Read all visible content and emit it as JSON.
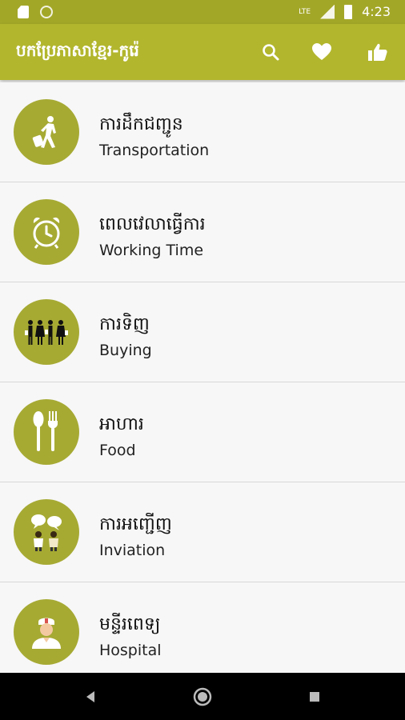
{
  "status": {
    "time": "4:23",
    "network": "LTE"
  },
  "app": {
    "title": "បកប្រែភាសាខ្មែរ-កូរ៉េ",
    "accent": "#b2b62d",
    "icon_color": "#a6aa33"
  },
  "actions": [
    {
      "icon": "search-icon"
    },
    {
      "icon": "heart-icon"
    },
    {
      "icon": "thumbs-up-icon"
    }
  ],
  "categories": [
    {
      "kh": "ការដឹកជញ្ជូន",
      "en": "Transportation",
      "icon": "traveler-icon"
    },
    {
      "kh": "ពេលវេលាធ្វើការ",
      "en": "Working Time",
      "icon": "alarm-clock-icon"
    },
    {
      "kh": "ការទិញ",
      "en": "Buying",
      "icon": "shoppers-icon"
    },
    {
      "kh": "អាហារ",
      "en": "Food",
      "icon": "spoon-fork-icon"
    },
    {
      "kh": "ការអញ្ជើញ",
      "en": "Inviation",
      "icon": "chat-people-icon"
    },
    {
      "kh": "មន្ទីរពេទ្យ",
      "en": "Hospital",
      "icon": "nurse-icon"
    }
  ]
}
